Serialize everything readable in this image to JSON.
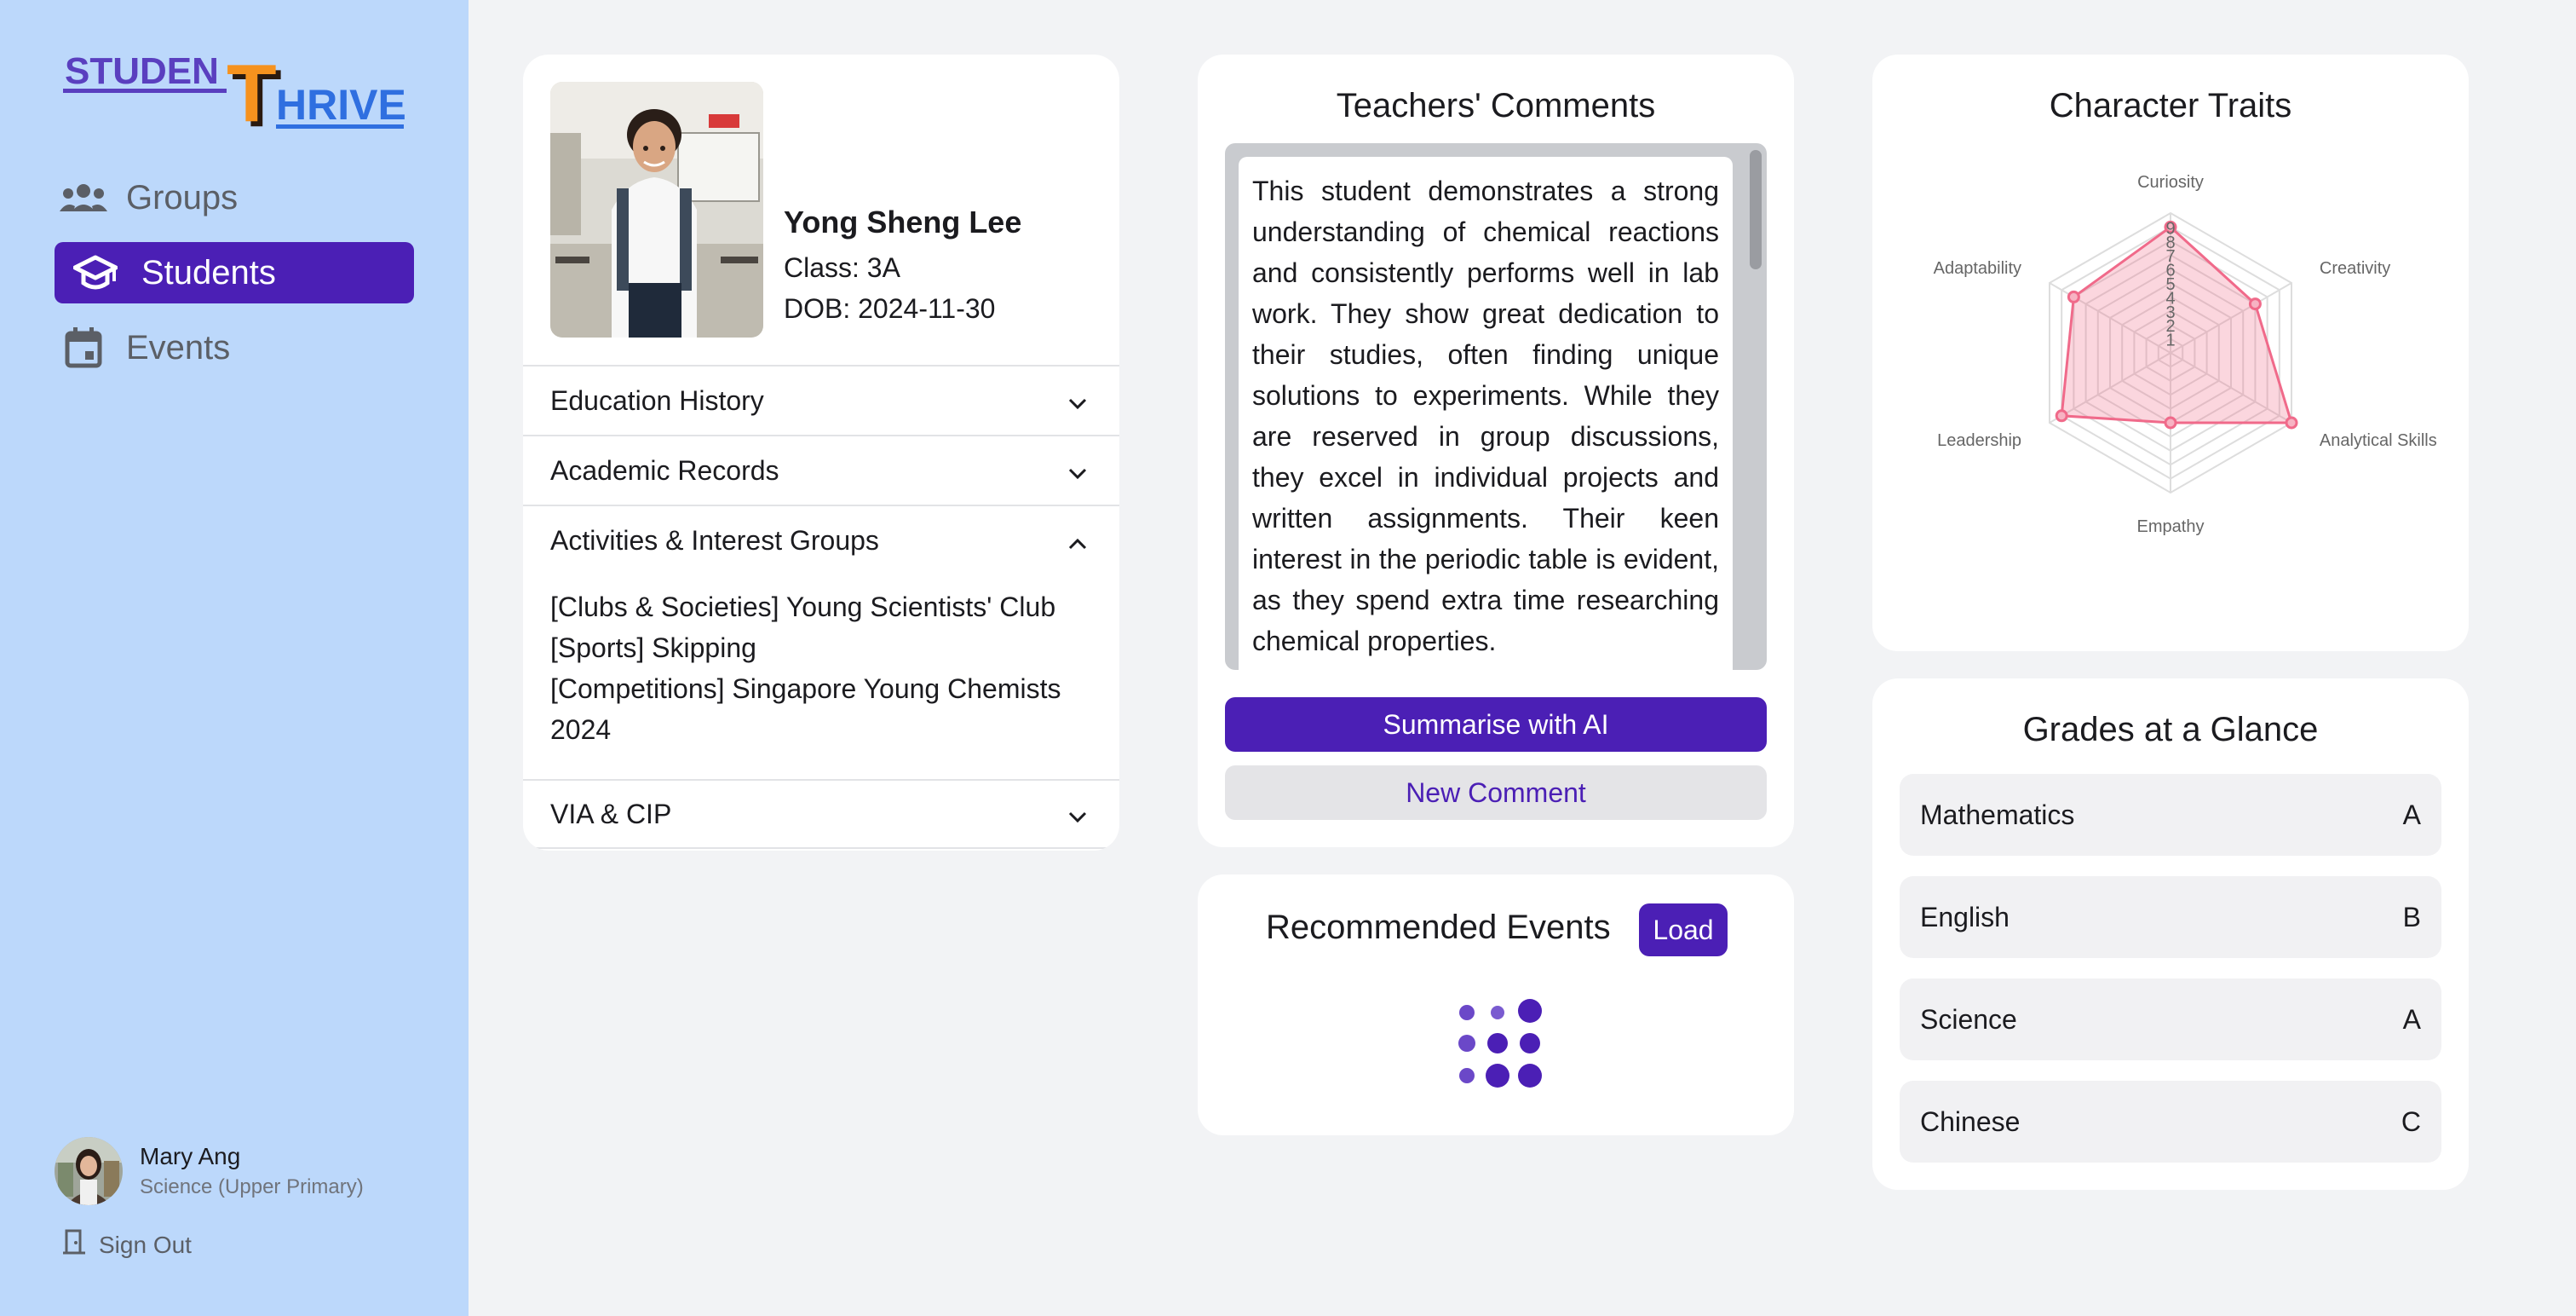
{
  "app": {
    "logo_text_1": "STUDEN",
    "logo_text_2": "T",
    "logo_text_3": "HRIVE"
  },
  "sidebar": {
    "items": [
      {
        "label": "Groups",
        "icon": "groups-icon",
        "active": false
      },
      {
        "label": "Students",
        "icon": "graduation-cap-icon",
        "active": true
      },
      {
        "label": "Events",
        "icon": "calendar-icon",
        "active": false
      }
    ],
    "user": {
      "name": "Mary Ang",
      "role": "Science (Upper Primary)"
    },
    "signout_label": "Sign Out"
  },
  "profile": {
    "name": "Yong Sheng Lee",
    "class": "Class: 3A",
    "dob": "DOB: 2024-11-30",
    "sections": [
      {
        "label": "Education History",
        "expanded": false
      },
      {
        "label": "Academic Records",
        "expanded": false
      },
      {
        "label": "Activities & Interest Groups",
        "expanded": true
      },
      {
        "label": "VIA & CIP",
        "expanded": false
      }
    ],
    "activities": [
      "[Clubs & Societies] Young Scientists' Club",
      "[Sports] Skipping",
      "[Competitions] Singapore Young Chemists 2024"
    ]
  },
  "comments": {
    "title": "Teachers' Comments",
    "text": "This student demonstrates a strong understanding of chemical reactions and consistently performs well in lab work. They show great dedication to their studies, often finding unique solutions to experiments. While they are reserved in group discussions, they excel in individual projects and written assignments. Their keen interest in the periodic table is evident, as they spend extra time researching chemical properties.",
    "summarise_label": "Summarise with AI",
    "new_comment_label": "New Comment"
  },
  "events": {
    "title": "Recommended Events",
    "load_label": "Load"
  },
  "traits": {
    "title": "Character Traits",
    "chart_data": {
      "type": "radar",
      "categories": [
        "Curiosity",
        "Creativity",
        "Analytical Skills",
        "Empathy",
        "Leadership",
        "Adaptability"
      ],
      "values": [
        9,
        7,
        10,
        5,
        9,
        8
      ],
      "range": [
        0,
        10
      ],
      "tick_labels": [
        "1",
        "2",
        "3",
        "4",
        "5",
        "6",
        "7",
        "8",
        "9"
      ],
      "color": "#f06a8a"
    }
  },
  "grades": {
    "title": "Grades at a Glance",
    "rows": [
      {
        "subject": "Mathematics",
        "grade": "A"
      },
      {
        "subject": "English",
        "grade": "B"
      },
      {
        "subject": "Science",
        "grade": "A"
      },
      {
        "subject": "Chinese",
        "grade": "C"
      }
    ]
  },
  "colors": {
    "accent": "#4b1fb5",
    "sidebar_bg": "#bcd8fb",
    "page_bg": "#f2f3f5"
  }
}
